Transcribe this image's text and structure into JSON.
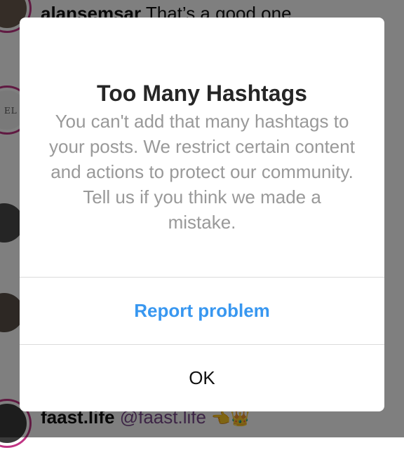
{
  "feed": {
    "comments": [
      {
        "username": "alansemsar",
        "text": "That’s a good one"
      },
      {
        "username": "faast.life",
        "text": "@faast.life"
      }
    ],
    "avatar_text": "EL M"
  },
  "dialog": {
    "title": "Too Many Hashtags",
    "body": "You can't add that many hashtags to your posts. We restrict certain content and actions to protect our community. Tell us if you think we made a mistake.",
    "report_label": "Report problem",
    "ok_label": "OK"
  },
  "colors": {
    "link_blue": "#3897f0",
    "body_gray": "#999999",
    "title_dark": "#262626",
    "overlay": "rgba(0,0,0,0.5)"
  }
}
